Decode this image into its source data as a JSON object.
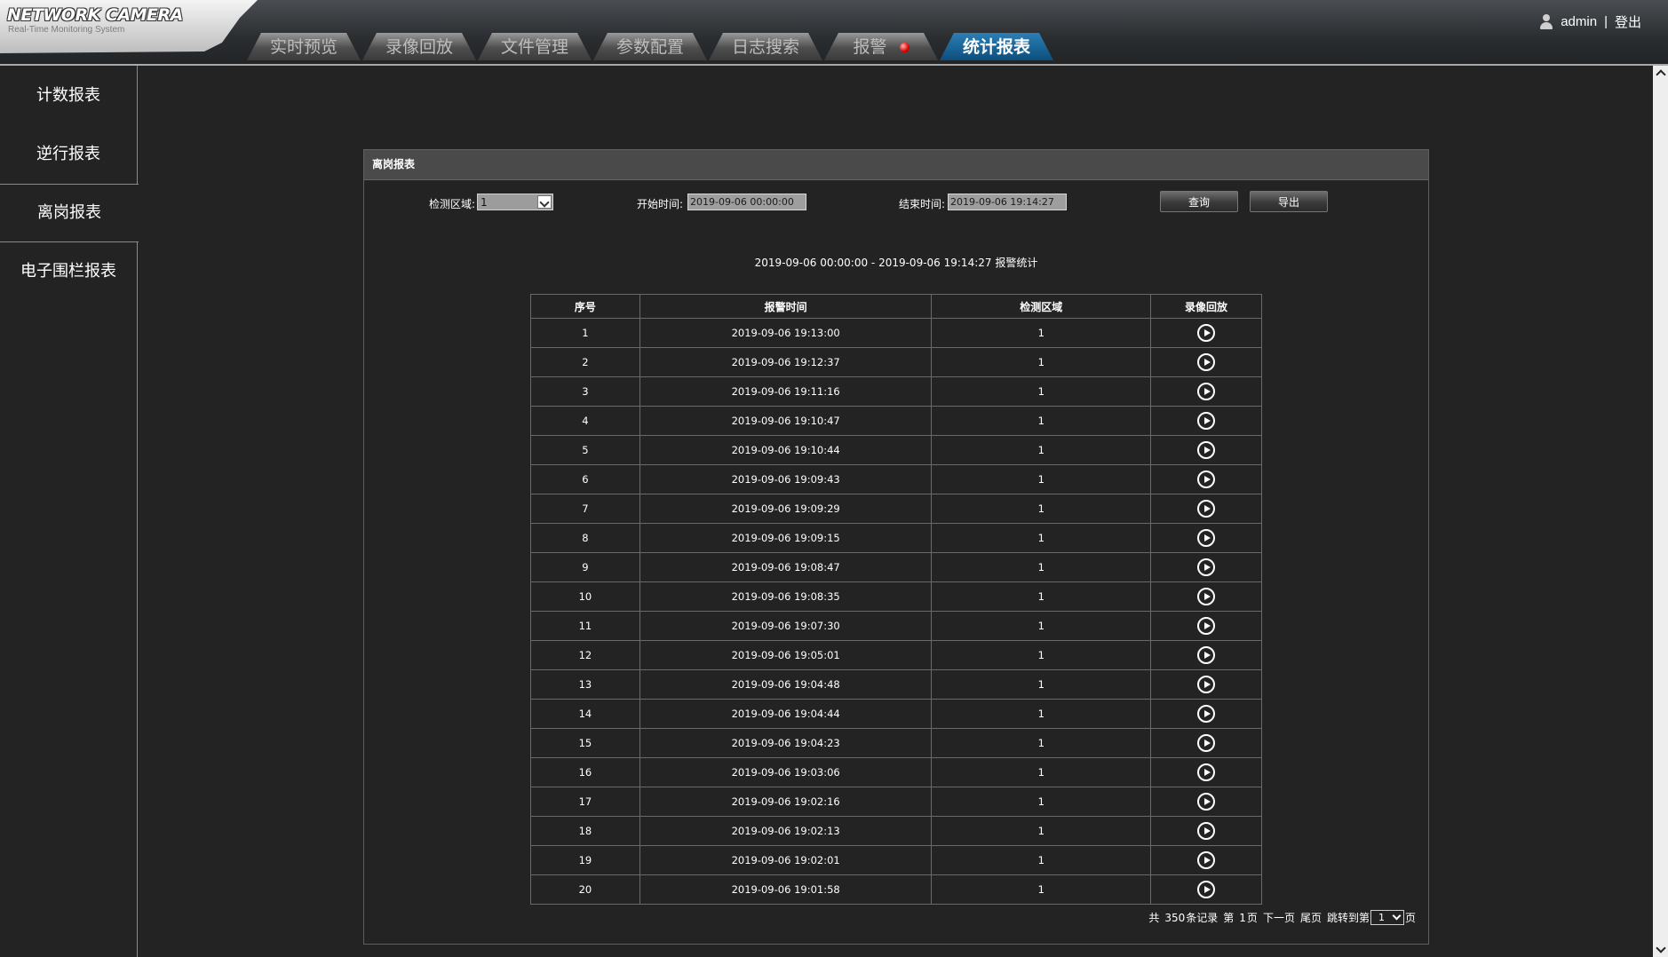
{
  "header": {
    "logo_title": "NETWORK CAMERA",
    "logo_subtitle": "Real-Time Monitoring System",
    "tabs": [
      {
        "label": "实时预览"
      },
      {
        "label": "录像回放"
      },
      {
        "label": "文件管理"
      },
      {
        "label": "参数配置"
      },
      {
        "label": "日志搜索"
      },
      {
        "label": "报警"
      },
      {
        "label": "统计报表"
      }
    ],
    "active_tab": "统计报表",
    "user": "admin",
    "separator": "|",
    "logout": "登出"
  },
  "sidebar": {
    "items": [
      {
        "label": "计数报表"
      },
      {
        "label": "逆行报表"
      },
      {
        "label": "离岗报表"
      },
      {
        "label": "电子围栏报表"
      }
    ],
    "active": "离岗报表"
  },
  "panel": {
    "title": "离岗报表",
    "region_label": "检测区域:",
    "region_value": "1",
    "start_label": "开始时间:",
    "start_value": "2019-09-06 00:00:00",
    "end_label": "结束时间:",
    "end_value": "2019-09-06 19:14:27",
    "query_button": "查询",
    "export_button": "导出",
    "summary": "2019-09-06 00:00:00 - 2019-09-06 19:14:27 报警统计"
  },
  "table": {
    "headers": [
      "序号",
      "报警时间",
      "检测区域",
      "录像回放"
    ],
    "rows": [
      {
        "no": "1",
        "time": "2019-09-06 19:13:00",
        "region": "1"
      },
      {
        "no": "2",
        "time": "2019-09-06 19:12:37",
        "region": "1"
      },
      {
        "no": "3",
        "time": "2019-09-06 19:11:16",
        "region": "1"
      },
      {
        "no": "4",
        "time": "2019-09-06 19:10:47",
        "region": "1"
      },
      {
        "no": "5",
        "time": "2019-09-06 19:10:44",
        "region": "1"
      },
      {
        "no": "6",
        "time": "2019-09-06 19:09:43",
        "region": "1"
      },
      {
        "no": "7",
        "time": "2019-09-06 19:09:29",
        "region": "1"
      },
      {
        "no": "8",
        "time": "2019-09-06 19:09:15",
        "region": "1"
      },
      {
        "no": "9",
        "time": "2019-09-06 19:08:47",
        "region": "1"
      },
      {
        "no": "10",
        "time": "2019-09-06 19:08:35",
        "region": "1"
      },
      {
        "no": "11",
        "time": "2019-09-06 19:07:30",
        "region": "1"
      },
      {
        "no": "12",
        "time": "2019-09-06 19:05:01",
        "region": "1"
      },
      {
        "no": "13",
        "time": "2019-09-06 19:04:48",
        "region": "1"
      },
      {
        "no": "14",
        "time": "2019-09-06 19:04:44",
        "region": "1"
      },
      {
        "no": "15",
        "time": "2019-09-06 19:04:23",
        "region": "1"
      },
      {
        "no": "16",
        "time": "2019-09-06 19:03:06",
        "region": "1"
      },
      {
        "no": "17",
        "time": "2019-09-06 19:02:16",
        "region": "1"
      },
      {
        "no": "18",
        "time": "2019-09-06 19:02:13",
        "region": "1"
      },
      {
        "no": "19",
        "time": "2019-09-06 19:02:01",
        "region": "1"
      },
      {
        "no": "20",
        "time": "2019-09-06 19:01:58",
        "region": "1"
      }
    ],
    "play_icon": "play-circle-icon"
  },
  "pager": {
    "total_prefix": "共",
    "total": "350",
    "total_suffix": "条记录",
    "page_prefix": "第",
    "page": "1",
    "page_suffix": "页",
    "next": "下一页",
    "last": "尾页",
    "jump_label": "跳转到第",
    "jump_value": "1",
    "jump_suffix": "页"
  },
  "colors": {
    "background": "#232323",
    "active_tab": "#1a6aa0",
    "alarm": "#e20000"
  }
}
